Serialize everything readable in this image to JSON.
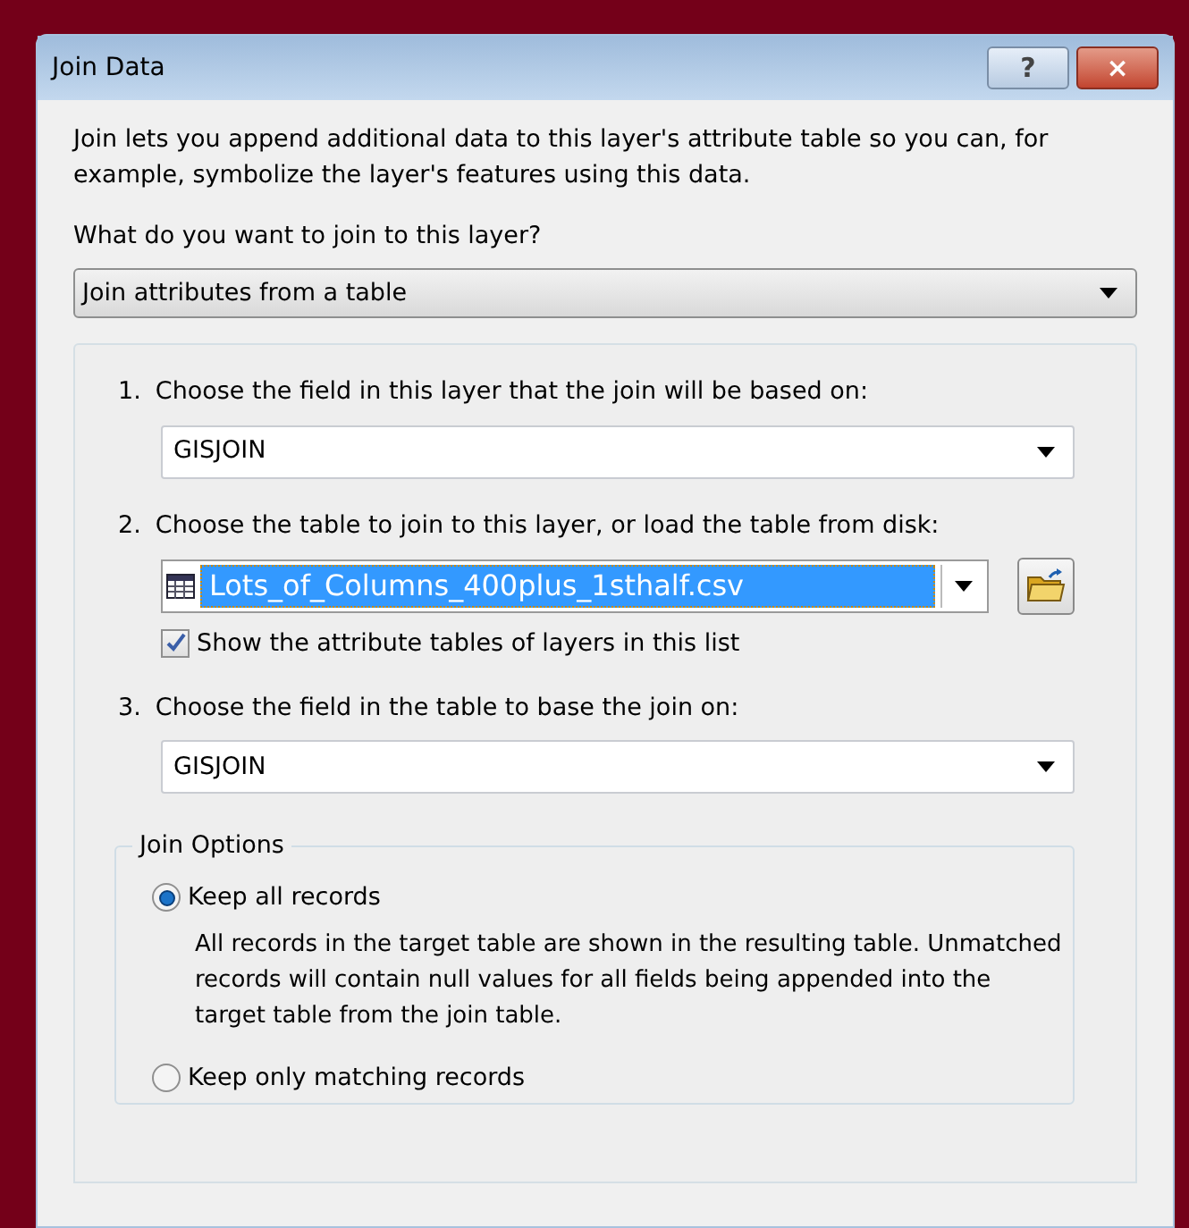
{
  "window": {
    "title": "Join Data",
    "buttons": [
      "?",
      "×"
    ]
  },
  "intro": "Join lets you append additional data to this layer's attribute table so you can, for example, symbolize the layer's features using this data.",
  "join_type": {
    "label": "What do you want to join to this layer?",
    "value": "Join attributes from a table"
  },
  "steps": [
    {
      "number": "1.",
      "label": "Choose the field in this layer that the join will be based on:",
      "kind": "dropdown",
      "value": "GISJOIN"
    },
    {
      "number": "2.",
      "label": "Choose the table to join to this layer, or load the table from disk:",
      "kind": "table",
      "value": "Lots_of_Columns_400plus_1sthalf.csv",
      "checkbox": {
        "label": "Show the attribute tables of layers in this list",
        "checked": true
      }
    },
    {
      "number": "3.",
      "label": "Choose the field in the table to base the join on:",
      "kind": "dropdown",
      "value": "GISJOIN"
    }
  ],
  "join_options": {
    "title": "Join Options",
    "options": [
      {
        "label": "Keep all records",
        "selected": true,
        "description": "All records in the target table are shown in the resulting table. Unmatched records will contain null values for all fields being appended into the target table from the join table."
      },
      {
        "label": "Keep only matching records",
        "selected": false
      }
    ]
  }
}
